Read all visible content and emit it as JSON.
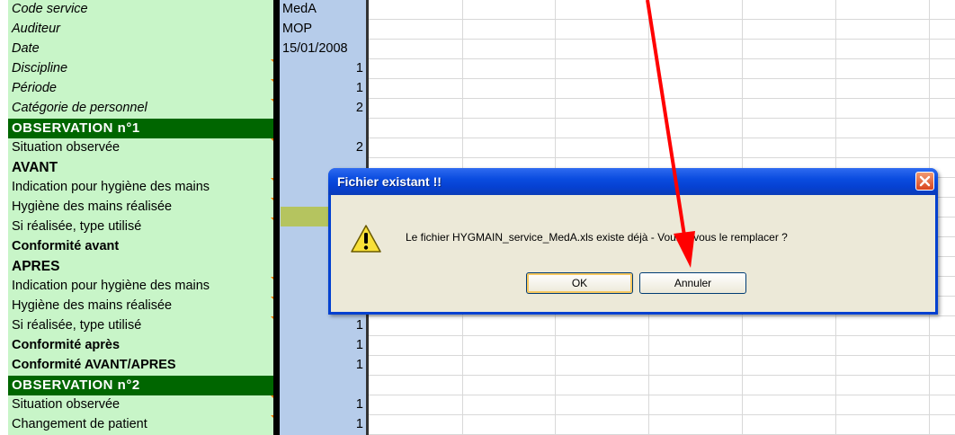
{
  "sheet": {
    "rows": [
      {
        "label": "Code service",
        "value": "MedA"
      },
      {
        "label": "Auditeur",
        "value": "MOP"
      },
      {
        "label": "Date",
        "value": "15/01/2008"
      },
      {
        "label": "Discipline",
        "value": "1"
      },
      {
        "label": "Période",
        "value": "1"
      },
      {
        "label": "Catégorie de personnel",
        "value": "2"
      },
      {
        "label": "OBSERVATION  n°1",
        "value": ""
      },
      {
        "label": "Situation observée",
        "value": "2"
      },
      {
        "label": "AVANT",
        "value": ""
      },
      {
        "label": "Indication pour hygiène des mains",
        "value": ""
      },
      {
        "label": "Hygiène des mains réalisée",
        "value": ""
      },
      {
        "label": "Si réalisée, type utilisé",
        "value": ""
      },
      {
        "label": "Conformité avant",
        "value": ""
      },
      {
        "label": "APRES",
        "value": ""
      },
      {
        "label": "Indication pour hygiène des mains",
        "value": ""
      },
      {
        "label": "Hygiène des mains réalisée",
        "value": "1"
      },
      {
        "label": "Si réalisée, type utilisé",
        "value": "1"
      },
      {
        "label": "Conformité après",
        "value": "1"
      },
      {
        "label": "Conformité AVANT/APRES",
        "value": "1"
      },
      {
        "label": "OBSERVATION  n°2",
        "value": ""
      },
      {
        "label": "Situation observée",
        "value": "1"
      },
      {
        "label": "Changement de patient",
        "value": "1"
      }
    ],
    "colors": {
      "label_bg": "#c8f5c8",
      "header_bg": "#006600",
      "value_bg": "#b6ccea",
      "highlight": "#b5c45f",
      "comment_marker": "#ff7a00"
    }
  },
  "dialog": {
    "title": "Fichier existant !!",
    "message": "Le fichier HYGMAIN_service_MedA.xls existe déjà - Voulez-vous le remplacer ?",
    "ok_label": "OK",
    "cancel_label": "Annuler",
    "icon": "warning-icon",
    "title_color": "#0a4ce0"
  },
  "annotation": {
    "arrow_color": "#ff0000",
    "points_to": "cancel-button"
  }
}
